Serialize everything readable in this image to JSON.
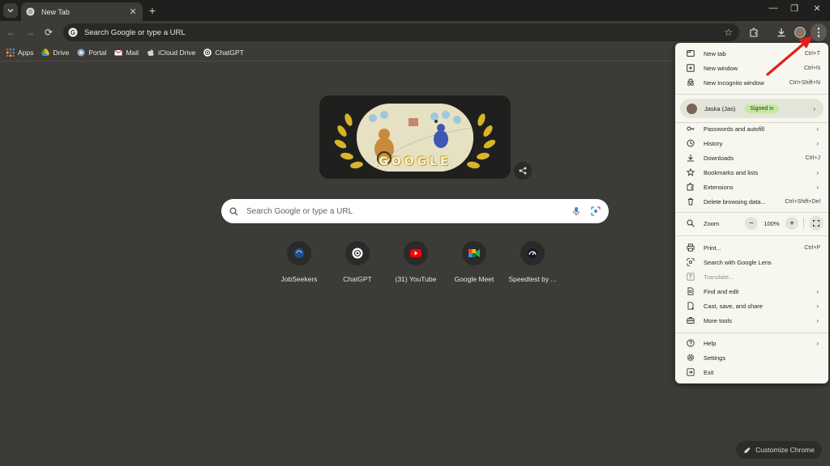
{
  "tabs": [
    {
      "title": "New Tab"
    }
  ],
  "omnibox": {
    "text": "Search Google or type a URL"
  },
  "bookmarks": [
    {
      "label": "Apps",
      "icon": "apps-grid-icon"
    },
    {
      "label": "Drive",
      "icon": "drive-icon"
    },
    {
      "label": "Portal",
      "icon": "globe-icon"
    },
    {
      "label": "Mail",
      "icon": "mail-icon"
    },
    {
      "label": "iCloud Drive",
      "icon": "apple-icon"
    },
    {
      "label": "ChatGPT",
      "icon": "chatgpt-icon"
    }
  ],
  "doodle": {
    "word": "GOOGLE"
  },
  "ntp_search": {
    "placeholder": "Search Google or type a URL"
  },
  "shortcuts": [
    {
      "label": "JobSeekers",
      "icon": "jobseekers-icon"
    },
    {
      "label": "ChatGPT",
      "icon": "chatgpt-icon"
    },
    {
      "label": "(31) YouTube",
      "icon": "youtube-icon"
    },
    {
      "label": "Google Meet",
      "icon": "google-meet-icon"
    },
    {
      "label": "Speedtest by ...",
      "icon": "speedtest-icon"
    }
  ],
  "customize": {
    "label": "Customize Chrome"
  },
  "menu": {
    "group1": [
      {
        "label": "New tab",
        "shortcut": "Ctrl+T",
        "icon": "new-tab-icon"
      },
      {
        "label": "New window",
        "shortcut": "Ctrl+N",
        "icon": "new-window-icon"
      },
      {
        "label": "New Incognito window",
        "shortcut": "Ctrl+Shift+N",
        "icon": "incognito-icon"
      }
    ],
    "profile": {
      "name": "Jaska (Jas)",
      "status": "Signed in"
    },
    "group2": [
      {
        "label": "Passwords and autofill",
        "shortcut": "",
        "submenu": true,
        "icon": "key-icon"
      },
      {
        "label": "History",
        "shortcut": "",
        "submenu": true,
        "icon": "history-icon"
      },
      {
        "label": "Downloads",
        "shortcut": "Ctrl+J",
        "submenu": false,
        "icon": "download-icon"
      },
      {
        "label": "Bookmarks and lists",
        "shortcut": "",
        "submenu": true,
        "icon": "star-icon"
      },
      {
        "label": "Extensions",
        "shortcut": "",
        "submenu": true,
        "icon": "extension-icon"
      },
      {
        "label": "Delete browsing data...",
        "shortcut": "Ctrl+Shift+Del",
        "submenu": false,
        "icon": "trash-icon"
      }
    ],
    "zoom": {
      "label": "Zoom",
      "value": "100%",
      "minus": "−",
      "plus": "+"
    },
    "group3": [
      {
        "label": "Print...",
        "shortcut": "Ctrl+P",
        "submenu": false,
        "disabled": false,
        "icon": "print-icon"
      },
      {
        "label": "Search with Google Lens",
        "shortcut": "",
        "submenu": false,
        "disabled": false,
        "icon": "lens-icon"
      },
      {
        "label": "Translate...",
        "shortcut": "",
        "submenu": false,
        "disabled": true,
        "icon": "translate-icon"
      },
      {
        "label": "Find and edit",
        "shortcut": "",
        "submenu": true,
        "disabled": false,
        "icon": "find-icon"
      },
      {
        "label": "Cast, save, and share",
        "shortcut": "",
        "submenu": true,
        "disabled": false,
        "icon": "cast-icon"
      },
      {
        "label": "More tools",
        "shortcut": "",
        "submenu": true,
        "disabled": false,
        "icon": "toolbox-icon"
      }
    ],
    "group4": [
      {
        "label": "Help",
        "shortcut": "",
        "submenu": true,
        "icon": "help-icon"
      },
      {
        "label": "Settings",
        "shortcut": "",
        "submenu": false,
        "icon": "settings-icon"
      },
      {
        "label": "Exit",
        "shortcut": "",
        "submenu": false,
        "icon": "exit-icon"
      }
    ]
  },
  "colors": {
    "page_bg": "#3c3b37",
    "menu_bg": "#f7f7f0",
    "annotation_arrow": "#e0201c",
    "signed_in_pill": "#c6e9a2"
  }
}
